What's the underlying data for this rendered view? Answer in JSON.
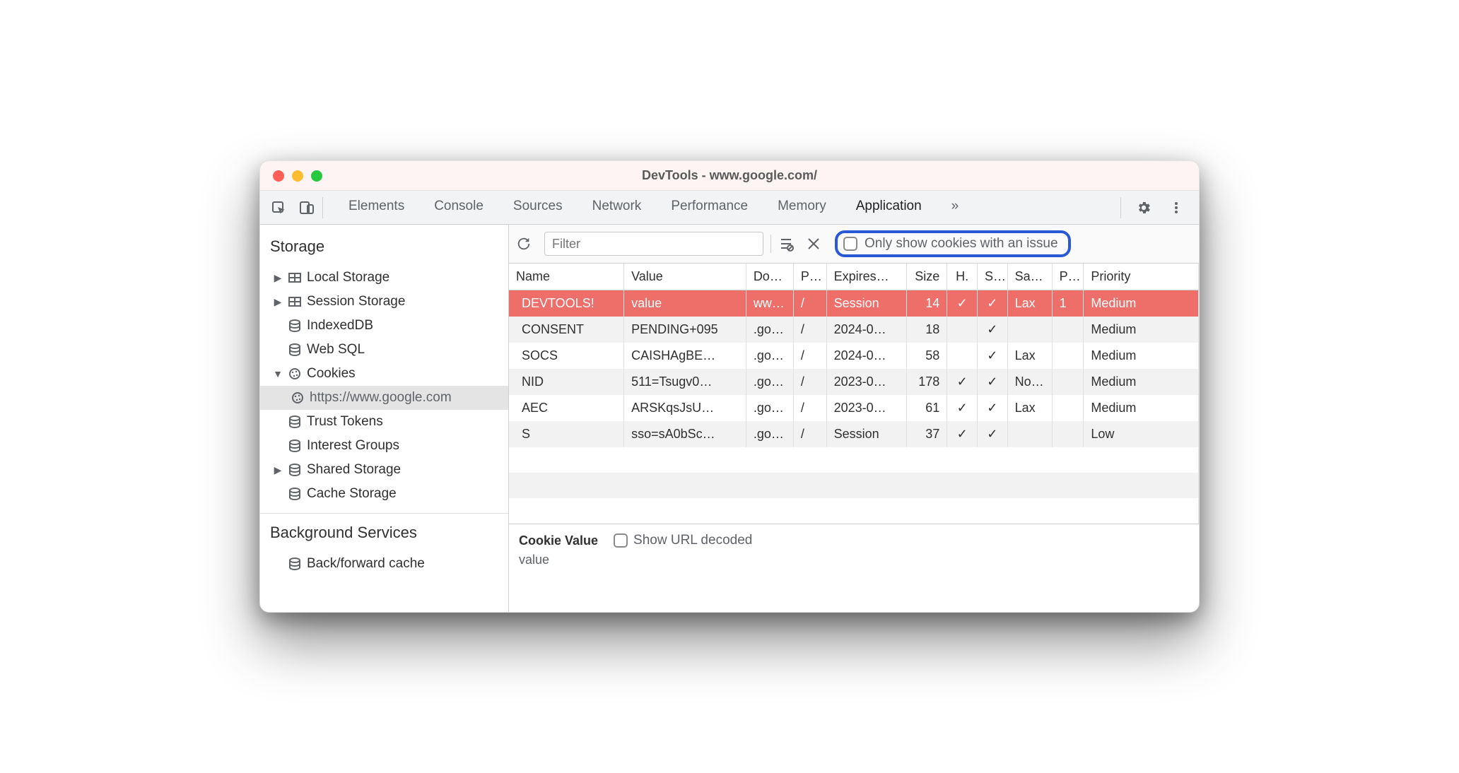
{
  "window_title": "DevTools - www.google.com/",
  "tabs": {
    "elements": "Elements",
    "console": "Console",
    "sources": "Sources",
    "network": "Network",
    "performance": "Performance",
    "memory": "Memory",
    "application": "Application",
    "more": "»"
  },
  "active_tab": "application",
  "sidebar": {
    "sections": {
      "storage": "Storage",
      "background": "Background Services"
    },
    "items": {
      "local_storage": "Local Storage",
      "session_storage": "Session Storage",
      "indexeddb": "IndexedDB",
      "web_sql": "Web SQL",
      "cookies": "Cookies",
      "cookies_origin": "https://www.google.com",
      "trust_tokens": "Trust Tokens",
      "interest_groups": "Interest Groups",
      "shared_storage": "Shared Storage",
      "cache_storage": "Cache Storage",
      "bf_cache": "Back/forward cache"
    }
  },
  "toolbar": {
    "filter_placeholder": "Filter",
    "only_issues_label": "Only show cookies with an issue"
  },
  "cookie_table": {
    "headers": {
      "name": "Name",
      "value": "Value",
      "domain": "Do…",
      "path": "P…",
      "expires": "Expires…",
      "size": "Size",
      "httponly": "H.",
      "secure": "S…",
      "samesite": "Sa…",
      "pk": "P…",
      "priority": "Priority"
    },
    "rows": [
      {
        "name": "DEVTOOLS!",
        "value": "value",
        "domain": "ww…",
        "path": "/",
        "expires": "Session",
        "size": "14",
        "httponly": "✓",
        "secure": "✓",
        "samesite": "Lax",
        "pk": "1",
        "priority": "Medium",
        "highlight": true
      },
      {
        "name": "CONSENT",
        "value": "PENDING+095",
        "domain": ".go…",
        "path": "/",
        "expires": "2024-0…",
        "size": "18",
        "httponly": "",
        "secure": "✓",
        "samesite": "",
        "pk": "",
        "priority": "Medium"
      },
      {
        "name": "SOCS",
        "value": "CAISHAgBE…",
        "domain": ".go…",
        "path": "/",
        "expires": "2024-0…",
        "size": "58",
        "httponly": "",
        "secure": "✓",
        "samesite": "Lax",
        "pk": "",
        "priority": "Medium"
      },
      {
        "name": "NID",
        "value": "511=Tsugv0…",
        "domain": ".go…",
        "path": "/",
        "expires": "2023-0…",
        "size": "178",
        "httponly": "✓",
        "secure": "✓",
        "samesite": "No…",
        "pk": "",
        "priority": "Medium"
      },
      {
        "name": "AEC",
        "value": "ARSKqsJsU…",
        "domain": ".go…",
        "path": "/",
        "expires": "2023-0…",
        "size": "61",
        "httponly": "✓",
        "secure": "✓",
        "samesite": "Lax",
        "pk": "",
        "priority": "Medium"
      },
      {
        "name": "S",
        "value": "sso=sA0bSc…",
        "domain": ".go…",
        "path": "/",
        "expires": "Session",
        "size": "37",
        "httponly": "✓",
        "secure": "✓",
        "samesite": "",
        "pk": "",
        "priority": "Low"
      }
    ]
  },
  "detail": {
    "label": "Cookie Value",
    "decode_label": "Show URL decoded",
    "value": "value"
  }
}
